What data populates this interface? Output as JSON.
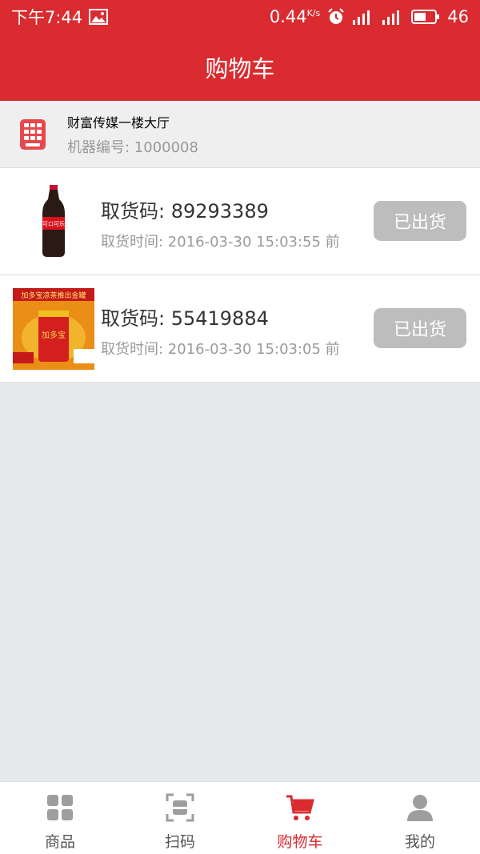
{
  "status_bar": {
    "time": "下午7:44",
    "speed": "0.44",
    "speed_unit": "K/s",
    "battery": "46"
  },
  "header": {
    "title": "购物车"
  },
  "machine": {
    "name": "财富传媒一楼大厅",
    "number": "机器编号: 1000008"
  },
  "orders": [
    {
      "product_logo": "可口可乐",
      "code": "取货码: 89293389",
      "time": "取货时间: 2016-03-30 15:03:55 前",
      "status": "已出货"
    },
    {
      "product_logo": "加多宝",
      "banner": "加多宝凉茶推出金罐",
      "code": "取货码: 55419884",
      "time": "取货时间: 2016-03-30 15:03:05 前",
      "status": "已出货"
    }
  ],
  "tabs": [
    {
      "label": "商品",
      "icon": "grid-icon"
    },
    {
      "label": "扫码",
      "icon": "scan-icon"
    },
    {
      "label": "购物车",
      "icon": "cart-icon",
      "active": true
    },
    {
      "label": "我的",
      "icon": "user-icon"
    }
  ],
  "colors": {
    "primary": "#d92b30",
    "status_button": "#bdbdbd",
    "background": "#e6e9ec"
  }
}
